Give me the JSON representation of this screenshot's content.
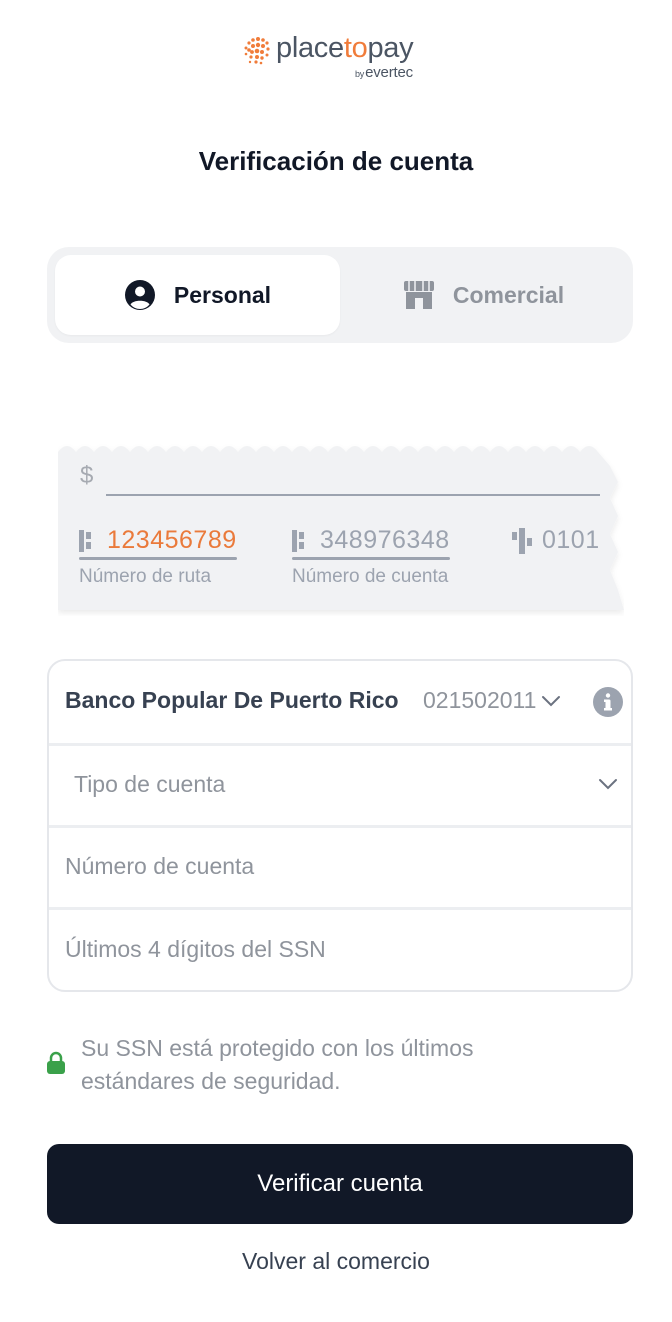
{
  "logo": {
    "part1": "place",
    "part2": "to",
    "part3": "pay",
    "sub_by": "by",
    "sub_brand": "evertec",
    "accent_color": "#f07c3a"
  },
  "page": {
    "title": "Verificación de cuenta"
  },
  "tabs": [
    {
      "label": "Personal",
      "icon": "user-circle-icon",
      "active": true
    },
    {
      "label": "Comercial",
      "icon": "storefront-icon",
      "active": false
    }
  ],
  "check": {
    "currency_symbol": "$",
    "routing_number": "123456789",
    "routing_label": "Número de ruta",
    "account_number": "348976348",
    "account_label": "Número de cuenta",
    "check_number": "0101"
  },
  "form": {
    "bank_name": "Banco Popular De Puerto Rico",
    "bank_code": "021502011",
    "account_type_placeholder": "Tipo de cuenta",
    "account_number_placeholder": "Número de cuenta",
    "ssn_placeholder": "Últimos 4 dígitos del SSN"
  },
  "security": {
    "line1": "Su SSN está protegido con los últimos",
    "line2": "estándares de seguridad.",
    "lock_color": "#3aa14a"
  },
  "actions": {
    "verify_label": "Verificar cuenta",
    "back_label": "Volver al comercio"
  },
  "colors": {
    "primary_button": "#111827",
    "muted_text": "#8f949c"
  }
}
